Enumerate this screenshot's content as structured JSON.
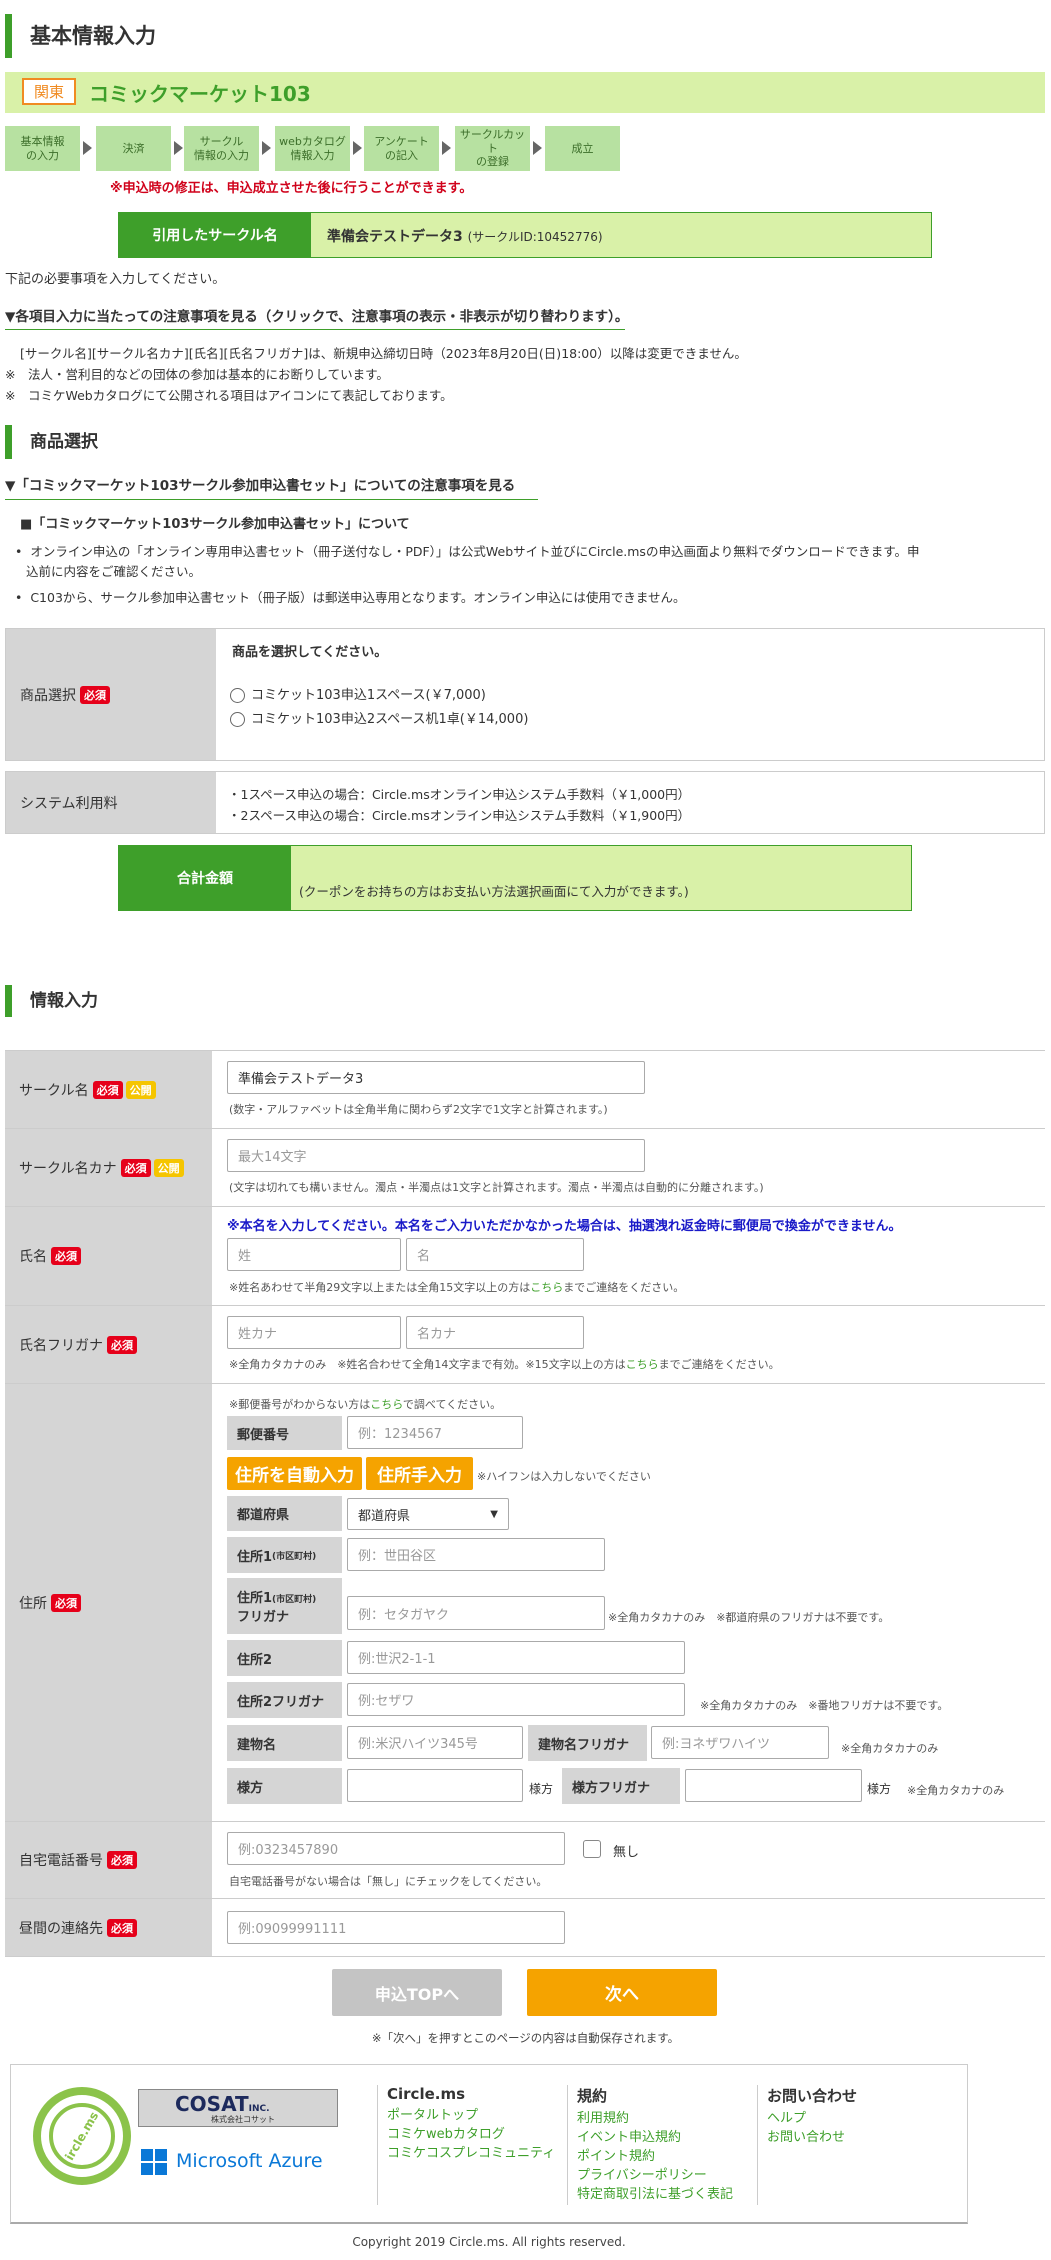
{
  "header": {
    "title": "基本情報入力"
  },
  "event": {
    "tag": "関東",
    "name": "コミックマーケット103"
  },
  "steps": [
    {
      "label": "基本情報\nの入力"
    },
    {
      "label": "決済"
    },
    {
      "label": "サークル\n情報の入力"
    },
    {
      "label": "webカタログ\n情報入力"
    },
    {
      "label": "アンケート\nの記入"
    },
    {
      "label": "サークルカット\nの登録"
    },
    {
      "label": "成立"
    }
  ],
  "steps_notice": "※申込時の修正は、申込成立させた後に行うことができます。",
  "quoted_circle": {
    "label": "引用したサークル名",
    "name": "準備会テストデータ3",
    "id_text": "(サークルID:10452776)"
  },
  "intro_text": "下記の必要事項を入力してください。",
  "notice_toggle": "▼各項目入力に当たっての注意事項を見る（クリックで、注意事項の表示・非表示が切り替わります）。",
  "notices": [
    "[サークル名][サークル名カナ][氏名][氏名フリガナ]は、新規申込締切日時（2023年8月20日(日)18:00）以降は変更できません。",
    "※　法人・営利目的などの団体の参加は基本的にお断りしています。",
    "※　コミケWebカタログにて公開される項目はアイコンにて表記しております。"
  ],
  "product_section": {
    "title": "商品選択",
    "toggle": "▼「コミックマーケット103サークル参加申込書セット」についての注意事項を見る",
    "subhead": "■「コミックマーケット103サークル参加申込書セット」について",
    "bullets": [
      "オンライン申込の「オンライン専用申込書セット（冊子送付なし・PDF）」は公式Webサイト並びにCircle.msの申込画面より無料でダウンロードできます。申",
      "込前に内容をご確認ください。",
      "C103から、サークル参加申込書セット（冊子版）は郵送申込専用となります。オンライン申込には使用できません。"
    ],
    "select_label": "商品選択",
    "select_prompt": "商品を選択してください。",
    "options": [
      "コミケット103申込1スペース(￥7,000)",
      "コミケット103申込2スペース机1卓(￥14,000)"
    ],
    "fee_label": "システム利用料",
    "fees": [
      "・1スペース申込の場合：Circle.msオンライン申込システム手数料（￥1,000円）",
      "・2スペース申込の場合：Circle.msオンライン申込システム手数料（￥1,900円）"
    ],
    "total_label": "合計金額",
    "total_note": "(クーポンをお持ちの方はお支払い方法選択画面にて入力ができます。)"
  },
  "badges": {
    "required": "必須",
    "public": "公開"
  },
  "info_section": {
    "title": "情報入力",
    "circle_name": {
      "label": "サークル名",
      "value": "準備会テストデータ3",
      "note": "(数字・アルファベットは全角半角に関わらず2文字で1文字と計算されます。)"
    },
    "circle_kana": {
      "label": "サークル名カナ",
      "placeholder": "最大14文字",
      "note": "(文字は切れても構いません。濁点・半濁点は1文字と計算されます。濁点・半濁点は自動的に分離されます。)"
    },
    "name": {
      "label": "氏名",
      "warning": "※本名を入力してください。本名をご入力いただかなかった場合は、抽選洩れ返金時に郵便局で換金ができません。",
      "sei_placeholder": "姓",
      "mei_placeholder": "名",
      "note_pre": "※姓名あわせて半角29文字以上または全角15文字以上の方は",
      "note_link": "こちら",
      "note_post": "までご連絡をください。"
    },
    "furigana": {
      "label": "氏名フリガナ",
      "sei_placeholder": "姓カナ",
      "mei_placeholder": "名カナ",
      "note_pre": "※全角カタカナのみ　※姓名合わせて全角14文字まで有効。※15文字以上の方は",
      "note_link": "こちら",
      "note_post": "までご連絡をください。"
    },
    "address": {
      "label": "住所",
      "top_note_pre": "※郵便番号がわからない方は",
      "top_note_link": "こちら",
      "top_note_post": "で調べてください。",
      "zip_label": "郵便番号",
      "zip_placeholder": "例：1234567",
      "auto_button": "住所を自動入力",
      "manual_button": "住所手入力",
      "hyphen_note": "※ハイフンは入力しないでください",
      "pref_label": "都道府県",
      "pref_value": "都道府県",
      "addr1_label": "住所1",
      "addr1_small": "(市区町村)",
      "addr1_placeholder": "例：世田谷区",
      "addr1k_label": "住所1",
      "addr1k_small": "(市区町村)",
      "addr1k_label2": "フリガナ",
      "addr1k_placeholder": "例：セタガヤク",
      "addr1k_note": "※全角カタカナのみ　※都道府県のフリガナは不要です。",
      "addr2_label": "住所2",
      "addr2_placeholder": "例:世沢2-1-1",
      "addr2k_label": "住所2フリガナ",
      "addr2k_placeholder": "例:セザワ",
      "addr2k_note": "※全角カタカナのみ　※番地フリガナは不要です。",
      "bldg_label": "建物名",
      "bldg_placeholder": "例:米沢ハイツ345号",
      "bldgk_label": "建物名フリガナ",
      "bldgk_placeholder": "例:ヨネザワハイツ",
      "bldgk_note": "※全角カタカナのみ",
      "sama_label": "様方",
      "sama_suffix": "様方",
      "samak_label": "様方フリガナ",
      "samak_suffix": "様方",
      "samak_note": "※全角カタカナのみ"
    },
    "home_phone": {
      "label": "自宅電話番号",
      "placeholder": "例:0323457890",
      "none_label": "無し",
      "note": "自宅電話番号がない場合は「無し」にチェックをしてください。"
    },
    "day_contact": {
      "label": "昼間の連絡先",
      "placeholder": "例:09099991111"
    }
  },
  "actions": {
    "back_label": "申込TOPへ",
    "next_label": "次へ",
    "autosave_note": "※「次へ」を押すとこのページの内容は自動保存されます。"
  },
  "footer": {
    "logo_text": "ircle.ms",
    "cosat_text": "COSAT",
    "cosat_inc": "INC.",
    "cosat_sub": "株式会社コサット",
    "azure_text": "Microsoft Azure",
    "cols": [
      {
        "title": "Circle.ms",
        "links": [
          "ポータルトップ",
          "コミケwebカタログ",
          "コミケコスプレコミュニティ"
        ]
      },
      {
        "title": "規約",
        "links": [
          "利用規約",
          "イベント申込規約",
          "ポイント規約",
          "プライバシーポリシー",
          "特定商取引法に基づく表記"
        ]
      },
      {
        "title": "お問い合わせ",
        "links": [
          "ヘルプ",
          "お問い合わせ"
        ]
      }
    ],
    "copyright": "Copyright 2019 Circle.ms. All rights reserved."
  },
  "colors": {
    "brand_green": "#3e9f2a",
    "light_green": "#d9f1a8",
    "step_green": "#b7e1a1",
    "required_red": "#e6001a",
    "public_yellow": "#f5c500",
    "orange": "#f5a300",
    "gray_label": "#d5d5d5"
  }
}
